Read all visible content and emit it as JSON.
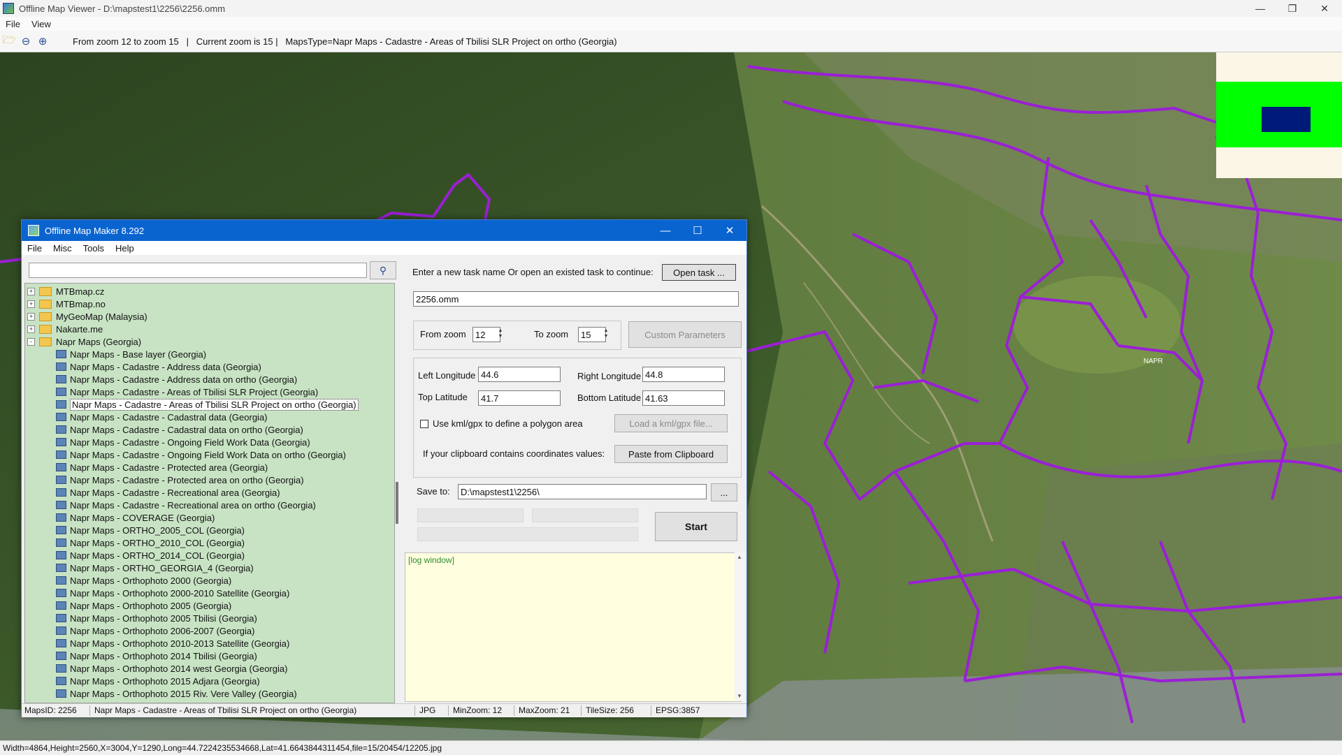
{
  "viewer": {
    "title": "Offline Map Viewer - D:\\mapstest1\\2256\\2256.omm",
    "menu": [
      "File",
      "View"
    ],
    "toolbar_status": "From zoom 12 to zoom 15   |   Current zoom is 15 |   MapsType=Napr Maps - Cadastre - Areas of Tbilisi SLR Project on ortho (Georgia)",
    "statusbar": "Width=4864,Height=2560,X=3004,Y=1290,Long=44.7224235534668,Lat=41.6643844311454,file=15/20454/12205.jpg",
    "map_label": "NAPR",
    "icons": [
      "open-folder-icon",
      "zoom-out-icon",
      "zoom-in-icon"
    ]
  },
  "dialog": {
    "title": "Offline Map Maker 8.292",
    "menu": [
      "File",
      "Misc",
      "Tools",
      "Help"
    ],
    "search_placeholder": "",
    "tree": [
      {
        "label": "MTBmap.cz",
        "type": "folder",
        "expander": "+"
      },
      {
        "label": "MTBmap.no",
        "type": "folder",
        "expander": "+"
      },
      {
        "label": "MyGeoMap (Malaysia)",
        "type": "folder",
        "expander": "+"
      },
      {
        "label": "Nakarte.me",
        "type": "folder",
        "expander": "+"
      },
      {
        "label": "Napr Maps (Georgia)",
        "type": "folder",
        "expander": "-"
      },
      {
        "label": "Napr Maps - Base layer (Georgia)",
        "type": "leaf"
      },
      {
        "label": "Napr Maps - Cadastre - Address data (Georgia)",
        "type": "leaf"
      },
      {
        "label": "Napr Maps - Cadastre - Address data on ortho (Georgia)",
        "type": "leaf"
      },
      {
        "label": "Napr Maps - Cadastre - Areas of Tbilisi SLR Project (Georgia)",
        "type": "leaf"
      },
      {
        "label": "Napr Maps - Cadastre - Areas of Tbilisi SLR Project on ortho (Georgia)",
        "type": "leaf",
        "selected": true
      },
      {
        "label": "Napr Maps - Cadastre - Cadastral data (Georgia)",
        "type": "leaf"
      },
      {
        "label": "Napr Maps - Cadastre - Cadastral data on ortho (Georgia)",
        "type": "leaf"
      },
      {
        "label": "Napr Maps - Cadastre - Ongoing Field Work Data (Georgia)",
        "type": "leaf"
      },
      {
        "label": "Napr Maps - Cadastre - Ongoing Field Work Data on ortho (Georgia)",
        "type": "leaf"
      },
      {
        "label": "Napr Maps - Cadastre - Protected area (Georgia)",
        "type": "leaf"
      },
      {
        "label": "Napr Maps - Cadastre - Protected area on ortho (Georgia)",
        "type": "leaf"
      },
      {
        "label": "Napr Maps - Cadastre - Recreational area (Georgia)",
        "type": "leaf"
      },
      {
        "label": "Napr Maps - Cadastre - Recreational area on ortho (Georgia)",
        "type": "leaf"
      },
      {
        "label": "Napr Maps - COVERAGE (Georgia)",
        "type": "leaf"
      },
      {
        "label": "Napr Maps - ORTHO_2005_COL (Georgia)",
        "type": "leaf"
      },
      {
        "label": "Napr Maps - ORTHO_2010_COL (Georgia)",
        "type": "leaf"
      },
      {
        "label": "Napr Maps - ORTHO_2014_COL (Georgia)",
        "type": "leaf"
      },
      {
        "label": "Napr Maps - ORTHO_GEORGIA_4 (Georgia)",
        "type": "leaf"
      },
      {
        "label": "Napr Maps - Orthophoto 2000 (Georgia)",
        "type": "leaf"
      },
      {
        "label": "Napr Maps - Orthophoto 2000-2010 Satellite (Georgia)",
        "type": "leaf"
      },
      {
        "label": "Napr Maps - Orthophoto 2005 (Georgia)",
        "type": "leaf"
      },
      {
        "label": "Napr Maps - Orthophoto 2005 Tbilisi (Georgia)",
        "type": "leaf"
      },
      {
        "label": "Napr Maps - Orthophoto 2006-2007 (Georgia)",
        "type": "leaf"
      },
      {
        "label": "Napr Maps - Orthophoto 2010-2013 Satellite (Georgia)",
        "type": "leaf"
      },
      {
        "label": "Napr Maps - Orthophoto 2014 Tbilisi (Georgia)",
        "type": "leaf"
      },
      {
        "label": "Napr Maps - Orthophoto 2014 west Georgia (Georgia)",
        "type": "leaf"
      },
      {
        "label": "Napr Maps - Orthophoto 2015 Adjara (Georgia)",
        "type": "leaf"
      },
      {
        "label": "Napr Maps - Orthophoto 2015 Riv. Vere Valley (Georgia)",
        "type": "leaf"
      }
    ],
    "task_prompt": "Enter a new task name Or open an existed task to continue:",
    "open_task_label": "Open task ...",
    "task_name": "2256.omm",
    "from_zoom_label": "From zoom",
    "from_zoom": "12",
    "to_zoom_label": "To zoom",
    "to_zoom": "15",
    "custom_params_label": "Custom Parameters",
    "left_lon_label": "Left Longitude",
    "left_lon": "44.6",
    "right_lon_label": "Right Longitude",
    "right_lon": "44.8",
    "top_lat_label": "Top Latitude",
    "top_lat": "41.7",
    "bottom_lat_label": "Bottom Latitude",
    "bottom_lat": "41.63",
    "kml_checkbox_label": "Use kml/gpx to define a polygon area",
    "kml_checked": false,
    "load_kml_label": "Load a kml/gpx file...",
    "clipboard_label": "If your clipboard contains coordinates values:",
    "paste_label": "Paste from Clipboard",
    "save_to_label": "Save to:",
    "save_to": "D:\\mapstest1\\2256\\",
    "browse_label": "...",
    "start_label": "Start",
    "log_text": "[log window]",
    "status": {
      "maps_id": "MapsID: 2256",
      "maps_name": "Napr Maps - Cadastre - Areas of Tbilisi SLR Project on ortho (Georgia)",
      "format": "JPG",
      "min_zoom": "MinZoom: 12",
      "max_zoom": "MaxZoom: 21",
      "tile_size": "TileSize: 256",
      "epsg": "EPSG:3857"
    }
  },
  "colors": {
    "boundary": "#9b1fd6",
    "dialog_title": "#0a64d0",
    "tree_bg": "#c8e3c4",
    "log_bg": "#ffffe0",
    "minimap_green": "#00ff00",
    "minimap_navy": "#001a7a"
  }
}
